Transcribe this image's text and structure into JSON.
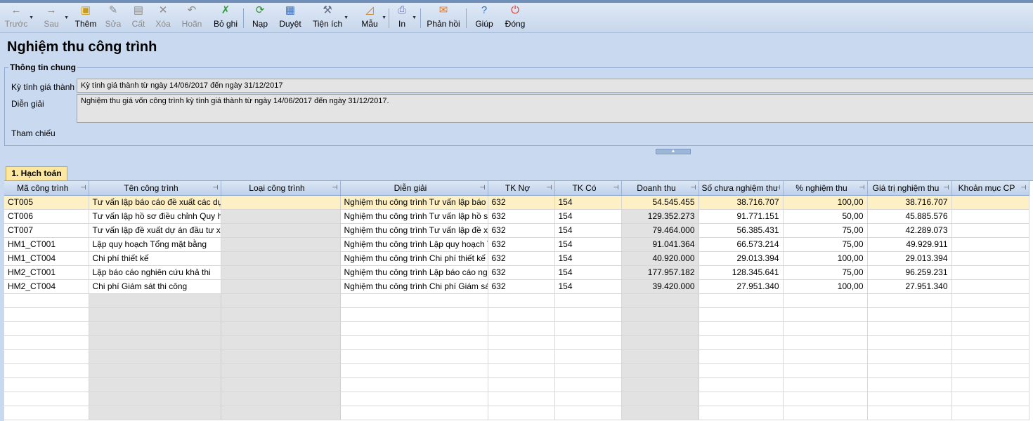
{
  "toolbar": {
    "buttons": [
      {
        "label": "Trước",
        "icon": "←",
        "enabled": false
      },
      {
        "label": "Sau",
        "icon": "→",
        "enabled": false
      },
      {
        "label": "Thêm",
        "icon": "▣",
        "enabled": true
      },
      {
        "label": "Sửa",
        "icon": "✎",
        "enabled": false
      },
      {
        "label": "Cất",
        "icon": "▤",
        "enabled": false
      },
      {
        "label": "Xóa",
        "icon": "✕",
        "enabled": false
      },
      {
        "label": "Hoãn",
        "icon": "↶",
        "enabled": false
      },
      {
        "label": "Bỏ ghi",
        "icon": "✗",
        "enabled": true
      },
      {
        "label": "Nạp",
        "icon": "⟳",
        "enabled": true
      },
      {
        "label": "Duyệt",
        "icon": "▦",
        "enabled": true
      },
      {
        "label": "Tiện ích",
        "icon": "⚒",
        "enabled": true
      },
      {
        "label": "Mẫu",
        "icon": "◿",
        "enabled": true
      },
      {
        "label": "In",
        "icon": "⎙",
        "enabled": true
      },
      {
        "label": "Phản hồi",
        "icon": "✉",
        "enabled": true
      },
      {
        "label": "Giúp",
        "icon": "?",
        "enabled": true
      },
      {
        "label": "Đóng",
        "icon": "⏻",
        "enabled": true
      }
    ]
  },
  "page": {
    "title": "Nghiệm thu công trình"
  },
  "info": {
    "group_title": "Thông tin chung",
    "period_label": "Kỳ tính giá thành",
    "period_value": "Kỳ tính giá thành từ ngày 14/06/2017 đến ngày 31/12/2017",
    "description_label": "Diễn giải",
    "description_value": "Nghiệm thu giá vốn công trình kỳ tính giá thành từ ngày 14/06/2017 đến ngày 31/12/2017.",
    "reference_label": "Tham chiếu"
  },
  "tab": {
    "label": "1. Hạch toán"
  },
  "grid": {
    "columns": [
      "Mã công trình",
      "Tên công trình",
      "Loại công trình",
      "Diễn giải",
      "TK Nợ",
      "TK Có",
      "Doanh thu",
      "Số chưa nghiệm thu",
      "% nghiệm thu",
      "Giá trị nghiệm thu",
      "Khoản mục CP"
    ],
    "rows": [
      [
        "CT005",
        "Tư vấn lập báo cáo đề xuất các dự",
        "",
        "Nghiệm thu công trình Tư vấn lập báo c",
        "632",
        "154",
        "54.545.455",
        "38.716.707",
        "100,00",
        "38.716.707",
        ""
      ],
      [
        "CT006",
        "Tư vấn lập hồ sơ điều chỉnh Quy ho",
        "",
        "Nghiệm thu công trình Tư vấn lập hồ sơ",
        "632",
        "154",
        "129.352.273",
        "91.771.151",
        "50,00",
        "45.885.576",
        ""
      ],
      [
        "CT007",
        "Tư vấn lập đề xuất dự án đầu tư xây",
        "",
        "Nghiệm thu công trình Tư vấn lập đề xu",
        "632",
        "154",
        "79.464.000",
        "56.385.431",
        "75,00",
        "42.289.073",
        ""
      ],
      [
        "HM1_CT001",
        "Lập quy hoạch Tổng mặt bằng",
        "",
        "Nghiệm thu công trình Lập quy hoạch T",
        "632",
        "154",
        "91.041.364",
        "66.573.214",
        "75,00",
        "49.929.911",
        ""
      ],
      [
        "HM1_CT004",
        "Chi phí thiết kế",
        "",
        "Nghiệm thu công trình Chi phí thiết kế",
        "632",
        "154",
        "40.920.000",
        "29.013.394",
        "100,00",
        "29.013.394",
        ""
      ],
      [
        "HM2_CT001",
        "Lập báo cáo nghiên cứu khả thi",
        "",
        "Nghiệm thu công trình Lập báo cáo nghi",
        "632",
        "154",
        "177.957.182",
        "128.345.641",
        "75,00",
        "96.259.231",
        ""
      ],
      [
        "HM2_CT004",
        "Chi phí Giám sát thi công",
        "",
        "Nghiệm thu công trình Chi phí Giám sát",
        "632",
        "154",
        "39.420.000",
        "27.951.340",
        "100,00",
        "27.951.340",
        ""
      ]
    ],
    "empty_rows": 9,
    "selected_row": 0
  }
}
